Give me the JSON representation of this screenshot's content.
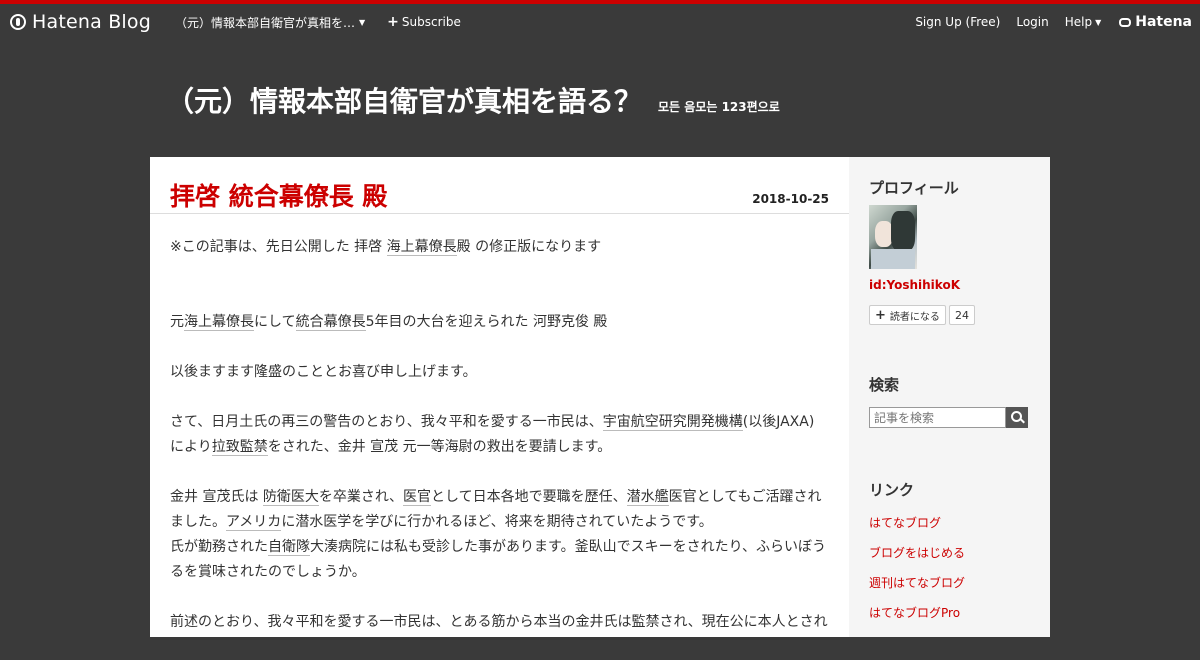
{
  "globalbar": {
    "logo": "Hatena Blog",
    "blog_menu": "（元）情報本部自衛官が真相を…",
    "subscribe": "Subscribe",
    "signup": "Sign Up (Free)",
    "login": "Login",
    "help": "Help",
    "hatena": "Hatena"
  },
  "blog": {
    "title": "（元）情報本部自衛官が真相を語る？",
    "description": "모든 음모는 123편으로"
  },
  "entry": {
    "title": "拝啓 統合幕僚長 殿",
    "date": "2018-10-25",
    "p1a": "※この記事は、先日公開した 拝啓 ",
    "p1link": "海上幕僚長",
    "p1b": "殿 の修正版になります",
    "p2a": "元",
    "p2link1": "海上幕僚長",
    "p2b": "にして",
    "p2link2": "統合幕僚長",
    "p2c": "5年目の大台を迎えられた 河野克俊 殿",
    "p3": "以後ますます隆盛のこととお喜び申し上げます。",
    "p4a": "さて、日月土氏の再三の警告のとおり、我々平和を愛する一市民は、",
    "p4link1": "宇宙航空研究開発機構",
    "p4b": "(以後JAXA)",
    "p4c": "により",
    "p4link2": "拉致監禁",
    "p4d": "をされた、金井 宣茂 元一等海尉の救出を要請します。",
    "p5a": "金井 宣茂氏は ",
    "p5link1": "防衛医大",
    "p5b": "を卒業され、",
    "p5link2": "医官",
    "p5c": "として日本各地で要職を歴任、",
    "p5link3": "潜水艦",
    "p5d": "医官としてもご活躍され",
    "p5e": "ました。",
    "p5link4": "アメリカ",
    "p5f": "に潜水医学を学びに行かれるほど、将来を期待されていたようです。",
    "p6a": "氏が勤務された",
    "p6link1": "自衛隊",
    "p6b": "大湊病院には私も受診した事があります。釜臥山でスキーをされたり、ふらいぼう",
    "p6c": "るを賞味されたのでしょうか。",
    "p7": "前述のとおり、我々平和を愛する一市民は、とある筋から本当の金井氏は監禁され、現在公に本人とされ"
  },
  "sidebar": {
    "profile_heading": "プロフィール",
    "user_id": "id:YoshihikoK",
    "subscribe_label": "読者になる",
    "subscriber_count": "24",
    "search_heading": "検索",
    "search_placeholder": "記事を検索",
    "links_heading": "リンク",
    "links": [
      "はてなブログ",
      "ブログをはじめる",
      "週刊はてなブログ",
      "はてなブログPro"
    ]
  },
  "colors": {
    "accent": "#cc0000",
    "background": "#3a3a3a",
    "content_bg": "#ffffff",
    "sidebar_bg": "#f5f5f5"
  }
}
